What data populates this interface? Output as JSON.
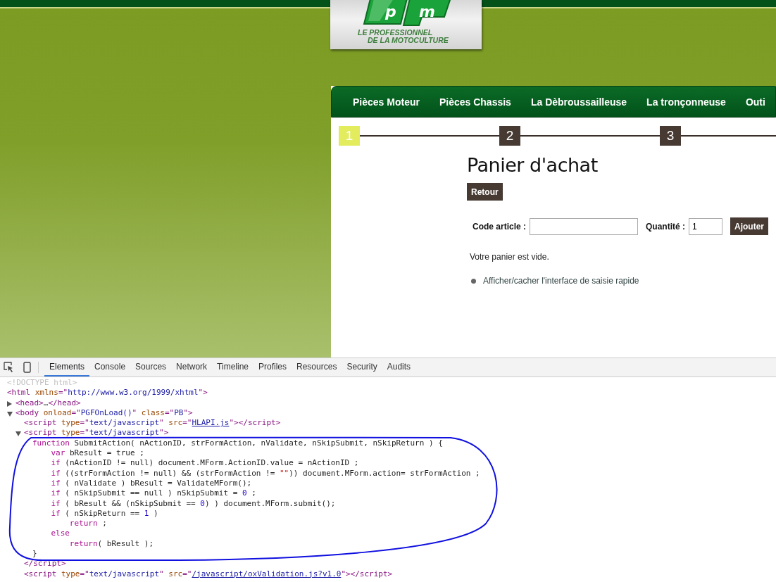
{
  "logo": {
    "letters": [
      "p",
      "m"
    ],
    "tagline": [
      "LE PROFESSIONNEL",
      "DE LA MOTOCULTURE"
    ]
  },
  "nav": {
    "items": [
      "Pièces Moteur",
      "Pièces Chassis",
      "La Dèbroussailleuse",
      "La tronçonneuse",
      "Outi"
    ]
  },
  "steps": [
    {
      "label": "1",
      "selected": true
    },
    {
      "label": "2",
      "selected": false
    },
    {
      "label": "3",
      "selected": false
    }
  ],
  "cart": {
    "title": "Panier d'achat",
    "back_button": "Retour",
    "code_label": "Code article :",
    "quantity_label": "Quantité :",
    "quantity_field": {
      "value": "1"
    },
    "add_button": "Ajouter",
    "empty_message": "Votre panier est vide.",
    "links": [
      "Afficher/cacher l'interface de saisie rapide"
    ]
  },
  "devtools": {
    "tabs": [
      {
        "label": "Elements",
        "selected": true
      },
      {
        "label": "Console",
        "selected": false
      },
      {
        "label": "Sources",
        "selected": false
      },
      {
        "label": "Network",
        "selected": false
      },
      {
        "label": "Timeline",
        "selected": false
      },
      {
        "label": "Profiles",
        "selected": false
      },
      {
        "label": "Resources",
        "selected": false
      },
      {
        "label": "Security",
        "selected": false
      },
      {
        "label": "Audits",
        "selected": false
      }
    ],
    "dom_tree": [
      {
        "kind": "element",
        "tokens": [
          {
            "kind": "doctype",
            "text": "<!DOCTYPE html>"
          }
        ]
      },
      {
        "kind": "element",
        "tokens": [
          {
            "kind": "tag",
            "text": "<html "
          },
          {
            "kind": "attr",
            "text": "xmlns"
          },
          {
            "kind": "tag",
            "text": "=\""
          },
          {
            "kind": "value",
            "text": "http://www.w3.org/1999/xhtml"
          },
          {
            "kind": "tag",
            "text": "\">"
          }
        ],
        "children": [
          {
            "kind": "element",
            "tokens": [
              {
                "kind": "tag",
                "text": "<head>"
              },
              {
                "kind": "plain",
                "text": "…"
              },
              {
                "kind": "tag",
                "text": "</head>"
              }
            ],
            "expanded": false
          },
          {
            "kind": "element",
            "tokens": [
              {
                "kind": "tag",
                "text": "<body "
              },
              {
                "kind": "attr",
                "text": "onload"
              },
              {
                "kind": "tag",
                "text": "=\""
              },
              {
                "kind": "value",
                "text": "PGFOnLoad()"
              },
              {
                "kind": "tag",
                "text": "\" "
              },
              {
                "kind": "attr",
                "text": "class"
              },
              {
                "kind": "tag",
                "text": "=\""
              },
              {
                "kind": "value",
                "text": "PB"
              },
              {
                "kind": "tag",
                "text": "\">"
              }
            ],
            "expanded": true,
            "children": [
              {
                "kind": "element",
                "tokens": [
                  {
                    "kind": "tag",
                    "text": "<script "
                  },
                  {
                    "kind": "attr",
                    "text": "type"
                  },
                  {
                    "kind": "tag",
                    "text": "=\""
                  },
                  {
                    "kind": "value",
                    "text": "text/javascript"
                  },
                  {
                    "kind": "tag",
                    "text": "\" "
                  },
                  {
                    "kind": "attr",
                    "text": "src"
                  },
                  {
                    "kind": "tag",
                    "text": "=\""
                  },
                  {
                    "kind": "link",
                    "text": "HLAPI.js"
                  },
                  {
                    "kind": "tag",
                    "text": "\"></script>"
                  }
                ]
              },
              {
                "kind": "element",
                "tokens": [
                  {
                    "kind": "tag",
                    "text": "<script "
                  },
                  {
                    "kind": "attr",
                    "text": "type"
                  },
                  {
                    "kind": "tag",
                    "text": "=\""
                  },
                  {
                    "kind": "value",
                    "text": "text/javascript"
                  },
                  {
                    "kind": "tag",
                    "text": "\">"
                  }
                ],
                "expanded": true,
                "children": [
                  {
                    "kind": "code",
                    "tokens": [
                      {
                        "kind": "keyword",
                        "text": "function"
                      },
                      {
                        "kind": "plain",
                        "text": " SubmitAction( nActionID, strFormAction, nValidate, nSkipSubmit, nSkipReturn ) {"
                      }
                    ],
                    "children": [
                      {
                        "kind": "code",
                        "tokens": [
                          {
                            "kind": "keyword",
                            "text": "var"
                          },
                          {
                            "kind": "plain",
                            "text": " bResult = true ;"
                          }
                        ]
                      },
                      {
                        "kind": "code",
                        "tokens": [
                          {
                            "kind": "keyword",
                            "text": "if"
                          },
                          {
                            "kind": "plain",
                            "text": " (nActionID != null) document.MForm.ActionID.value = nActionID ;"
                          }
                        ]
                      },
                      {
                        "kind": "code",
                        "tokens": [
                          {
                            "kind": "keyword",
                            "text": "if"
                          },
                          {
                            "kind": "plain",
                            "text": " ((strFormAction != null) && (strFormAction != "
                          },
                          {
                            "kind": "string",
                            "text": "\"\""
                          },
                          {
                            "kind": "plain",
                            "text": ")) document.MForm.action= strFormAction ;"
                          }
                        ]
                      },
                      {
                        "kind": "code",
                        "tokens": [
                          {
                            "kind": "keyword",
                            "text": "if"
                          },
                          {
                            "kind": "plain",
                            "text": " ( nValidate ) bResult = ValidateMForm();"
                          }
                        ]
                      },
                      {
                        "kind": "code",
                        "tokens": [
                          {
                            "kind": "keyword",
                            "text": "if"
                          },
                          {
                            "kind": "plain",
                            "text": " ( nSkipSubmit == null ) nSkipSubmit = "
                          },
                          {
                            "kind": "number",
                            "text": "0"
                          },
                          {
                            "kind": "plain",
                            "text": " ;"
                          }
                        ]
                      },
                      {
                        "kind": "code",
                        "tokens": [
                          {
                            "kind": "keyword",
                            "text": "if"
                          },
                          {
                            "kind": "plain",
                            "text": " ( bResult && (nSkipSubmit == "
                          },
                          {
                            "kind": "number",
                            "text": "0"
                          },
                          {
                            "kind": "plain",
                            "text": ") ) document.MForm.submit();"
                          }
                        ]
                      },
                      {
                        "kind": "code",
                        "tokens": [
                          {
                            "kind": "keyword",
                            "text": "if"
                          },
                          {
                            "kind": "plain",
                            "text": " ( nSkipReturn == "
                          },
                          {
                            "kind": "number",
                            "text": "1"
                          },
                          {
                            "kind": "plain",
                            "text": " )"
                          }
                        ],
                        "children": [
                          {
                            "kind": "code",
                            "tokens": [
                              {
                                "kind": "keyword",
                                "text": "return"
                              },
                              {
                                "kind": "plain",
                                "text": " ;"
                              }
                            ]
                          }
                        ]
                      },
                      {
                        "kind": "code",
                        "tokens": [
                          {
                            "kind": "keyword",
                            "text": "else"
                          }
                        ],
                        "children": [
                          {
                            "kind": "code",
                            "tokens": [
                              {
                                "kind": "keyword",
                                "text": "return"
                              },
                              {
                                "kind": "plain",
                                "text": "( bResult );"
                              }
                            ]
                          }
                        ]
                      }
                    ]
                  },
                  {
                    "kind": "code",
                    "tokens": [
                      {
                        "kind": "plain",
                        "text": "}"
                      }
                    ]
                  }
                ]
              },
              {
                "kind": "element",
                "tokens": [
                  {
                    "kind": "tag",
                    "text": "</script>"
                  }
                ]
              },
              {
                "kind": "element",
                "tokens": [
                  {
                    "kind": "tag",
                    "text": "<script "
                  },
                  {
                    "kind": "attr",
                    "text": "type"
                  },
                  {
                    "kind": "tag",
                    "text": "=\""
                  },
                  {
                    "kind": "value",
                    "text": "text/javascript"
                  },
                  {
                    "kind": "tag",
                    "text": "\" "
                  },
                  {
                    "kind": "attr",
                    "text": "src"
                  },
                  {
                    "kind": "tag",
                    "text": "=\""
                  },
                  {
                    "kind": "link",
                    "text": "/javascript/oxValidation.js?v1.0"
                  },
                  {
                    "kind": "tag",
                    "text": "\"></script>"
                  }
                ]
              }
            ]
          }
        ]
      }
    ]
  }
}
